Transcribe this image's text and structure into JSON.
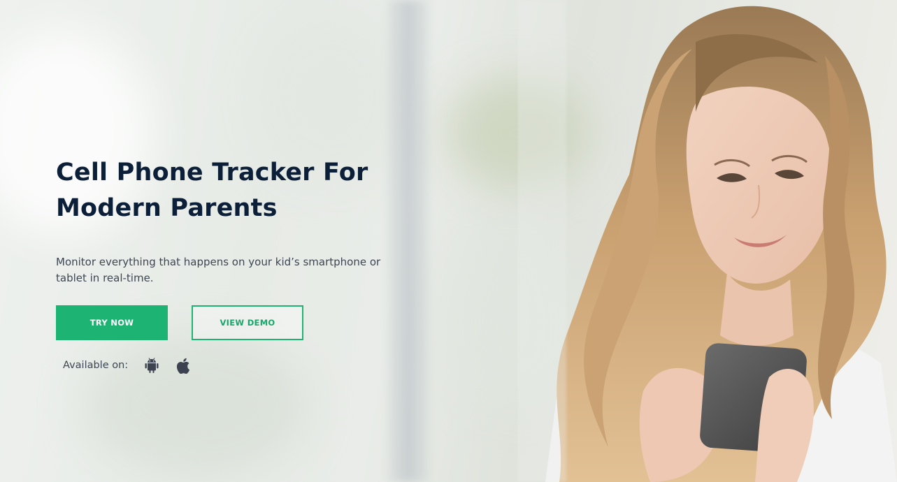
{
  "hero": {
    "title_line1": "Cell Phone Tracker For",
    "title_line2": "Modern Parents",
    "subtitle": "Monitor everything that happens on your kid’s smartphone or tablet in real-time.",
    "primary_button": "TRY NOW",
    "secondary_button": "VIEW DEMO",
    "available_label": "Available on:",
    "platform_icons": [
      "android-icon",
      "apple-icon"
    ]
  },
  "colors": {
    "accent": "#1db473",
    "heading": "#0c1f38",
    "body_text": "#3e4653"
  },
  "image": {
    "subject": "woman-with-long-wavy-hair-smiling-at-smartphone"
  }
}
